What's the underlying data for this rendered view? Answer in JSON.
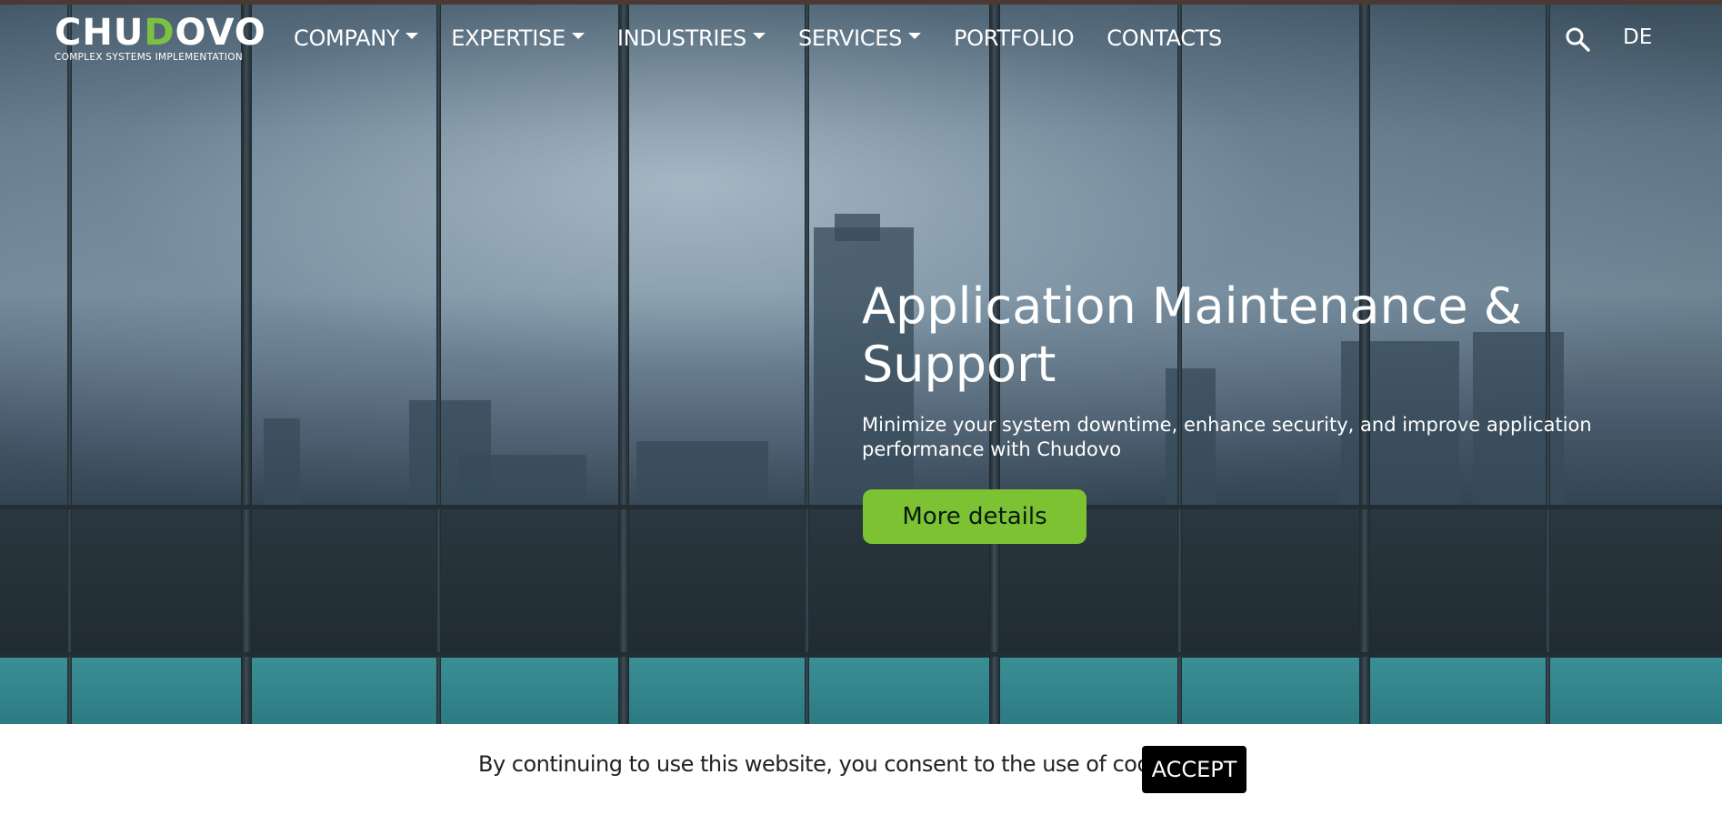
{
  "brand": {
    "name_part1": "CHU",
    "name_leaf": "D",
    "name_part2": "OVO",
    "tagline": "COMPLEX SYSTEMS IMPLEMENTATION",
    "accent_color": "#7cc242"
  },
  "nav": {
    "items": [
      {
        "label": "COMPANY",
        "dropdown": true
      },
      {
        "label": "EXPERTISE",
        "dropdown": true
      },
      {
        "label": "INDUSTRIES",
        "dropdown": true
      },
      {
        "label": "SERVICES",
        "dropdown": true
      },
      {
        "label": "PORTFOLIO",
        "dropdown": false
      },
      {
        "label": "CONTACTS",
        "dropdown": false
      }
    ],
    "search_icon": "search-icon",
    "language": "DE"
  },
  "hero": {
    "title": "Application Maintenance & Support",
    "subtitle": "Minimize your system downtime, enhance security, and improve application performance with Chudovo",
    "cta_label": "More details",
    "cta_color": "#7cc232"
  },
  "cookie_banner": {
    "text": "By continuing to use this website, you consent to the use of cookies.",
    "accept_label": "ACCEPT"
  }
}
